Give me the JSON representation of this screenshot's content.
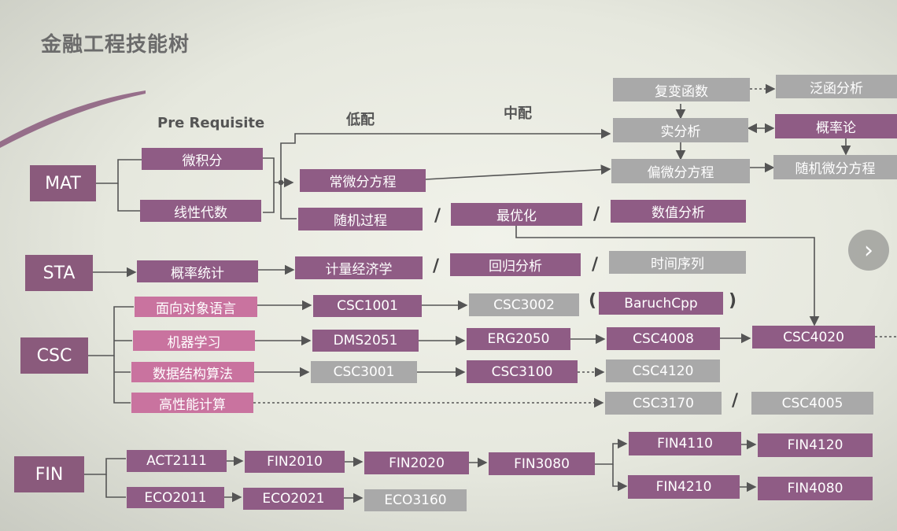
{
  "title": "金融工程技能树",
  "headers": {
    "prereq": "Pre Requisite",
    "low": "低配",
    "mid": "中配"
  },
  "categories": {
    "mat": "MAT",
    "sta": "STA",
    "csc": "CSC",
    "fin": "FIN"
  },
  "mat": {
    "calculus": "微积分",
    "linear_algebra": "线性代数",
    "ode": "常微分方程",
    "stochastic": "随机过程",
    "optimization": "最优化",
    "numerical": "数值分析",
    "complex": "复变函数",
    "functional": "泛函分析",
    "real_analysis": "实分析",
    "probability": "概率论",
    "pde": "偏微分方程",
    "sde": "随机微分方程"
  },
  "sta": {
    "prob_stats": "概率统计",
    "econometrics": "计量经济学",
    "regression": "回归分析",
    "time_series": "时间序列"
  },
  "csc": {
    "oop": "面向对象语言",
    "ml": "机器学习",
    "dsa": "数据结构算法",
    "hpc": "高性能计算",
    "csc1001": "CSC1001",
    "csc3002": "CSC3002",
    "baruch": "BaruchCpp",
    "dms2051": "DMS2051",
    "erg2050": "ERG2050",
    "csc4008": "CSC4008",
    "csc4020": "CSC4020",
    "csc3001": "CSC3001",
    "csc3100": "CSC3100",
    "csc4120": "CSC4120",
    "csc3170": "CSC3170",
    "csc4005": "CSC4005"
  },
  "fin": {
    "act2111": "ACT2111",
    "fin2010": "FIN2010",
    "fin2020": "FIN2020",
    "fin3080": "FIN3080",
    "fin4110": "FIN4110",
    "fin4120": "FIN4120",
    "fin4210": "FIN4210",
    "fin4080": "FIN4080",
    "eco2011": "ECO2011",
    "eco2021": "ECO2021",
    "eco3160": "ECO3160"
  },
  "separators": {
    "slash": "/",
    "paren_open": "(",
    "paren_close": ")"
  },
  "colors": {
    "purple": "#8f5c85",
    "pink": "#c9739f",
    "gray": "#a9a9a9",
    "category": "#8a5a7c"
  },
  "icons": {
    "next": "chevron-right-icon"
  }
}
